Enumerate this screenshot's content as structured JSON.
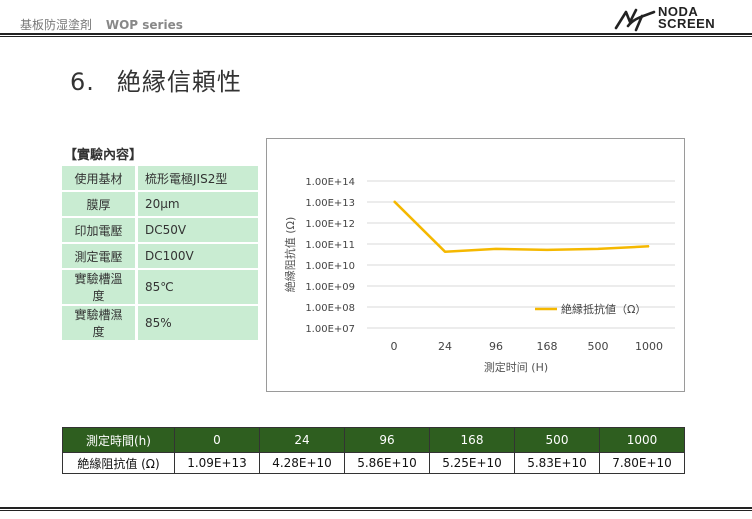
{
  "header": {
    "text": "基板防湿塗剤",
    "series": "WOP series",
    "logo": {
      "line1": "NODA",
      "line2": "SCREEN"
    }
  },
  "title": {
    "number": "6.",
    "text": "絶縁信頼性"
  },
  "experiment": {
    "label": "【實驗內容】",
    "rows": [
      {
        "key": "使用基材",
        "value": "梳形電極JIS2型"
      },
      {
        "key": "膜厚",
        "value": "20µm"
      },
      {
        "key": "印加電壓",
        "value": "DC50V"
      },
      {
        "key": "測定電壓",
        "value": "DC100V"
      },
      {
        "key": "實驗槽溫度",
        "value": "85℃"
      },
      {
        "key": "實驗槽濕度",
        "value": "85%"
      }
    ]
  },
  "chart_data": {
    "type": "line",
    "categories": [
      "0",
      "24",
      "96",
      "168",
      "500",
      "1000"
    ],
    "series": [
      {
        "name": "絶縁抵抗値（Ω）",
        "values": [
          10900000000000.0,
          42800000000.0,
          58600000000.0,
          52500000000.0,
          58300000000.0,
          78000000000.0
        ],
        "color": "#f5b800"
      }
    ],
    "ylabel": "絶縁阻抗值 (Ω)",
    "xlabel": "測定时间 (H)",
    "yscale": "log",
    "ylim": [
      10000000.0,
      100000000000000.0
    ],
    "yticks": [
      "1.00E+07",
      "1.00E+08",
      "1.00E+09",
      "1.00E+10",
      "1.00E+11",
      "1.00E+12",
      "1.00E+13",
      "1.00E+14"
    ],
    "grid": true,
    "legend": "right"
  },
  "data_table": {
    "header_label": "測定時間(h)",
    "row_label": "絶緣阻抗值 (Ω)",
    "times": [
      "0",
      "24",
      "96",
      "168",
      "500",
      "1000"
    ],
    "values": [
      "1.09E+13",
      "4.28E+10",
      "5.86E+10",
      "5.25E+10",
      "5.83E+10",
      "7.80E+10"
    ]
  },
  "colors": {
    "header_green": "#2e5e1f",
    "spec_green": "#c9ecd2",
    "line": "#f5b800"
  }
}
